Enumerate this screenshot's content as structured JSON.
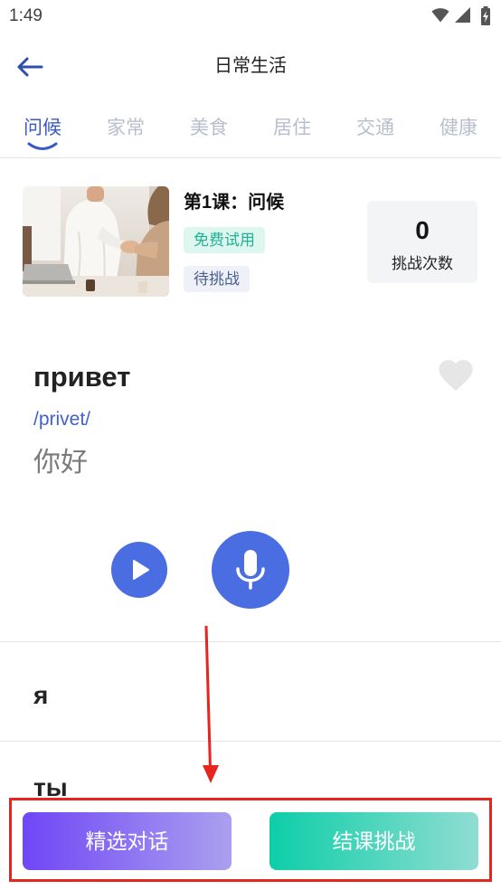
{
  "status_bar": {
    "time": "1:49",
    "icons": [
      "wifi-icon",
      "cellular-signal-icon",
      "battery-charging-icon"
    ]
  },
  "header": {
    "title": "日常生活",
    "back_icon": "arrow-left-icon"
  },
  "tabs": [
    {
      "label": "问候",
      "active": true
    },
    {
      "label": "家常",
      "active": false
    },
    {
      "label": "美食",
      "active": false
    },
    {
      "label": "居住",
      "active": false
    },
    {
      "label": "交通",
      "active": false
    },
    {
      "label": "健康",
      "active": false
    }
  ],
  "lesson": {
    "title": "第1课：问候",
    "badges": [
      "免费试用",
      "待挑战"
    ],
    "challenge_count": 0,
    "challenge_count_label": "挑战次数"
  },
  "current_word": {
    "word": "привет",
    "phonetic": "/privet/",
    "translation": "你好",
    "favorited": false,
    "favorite_icon": "heart-icon",
    "play_icon": "play-icon",
    "record_icon": "microphone-icon"
  },
  "word_list": [
    {
      "word": "я"
    },
    {
      "word": "ты"
    }
  ],
  "bottom_bar": {
    "dialog_button": "精选对话",
    "challenge_button": "结课挑战"
  },
  "theme": {
    "accent": "#4a6de2",
    "tab_active": "#3a5ac6",
    "tab_inactive": "#b7bfcc",
    "back_arrow": "#2c4fae",
    "phonetic": "#4262c6",
    "free_badge_bg": "#ddf6ef",
    "free_badge_text": "#23b394",
    "pending_badge_bg": "#eef1f8",
    "pending_badge_text": "#4b5e8d",
    "dialog_button_gradient": [
      "#7046f6",
      "#aaa0ef"
    ],
    "challenge_button_gradient": [
      "#0dcea8",
      "#90ddd2"
    ],
    "annotation": "#e8241f"
  }
}
